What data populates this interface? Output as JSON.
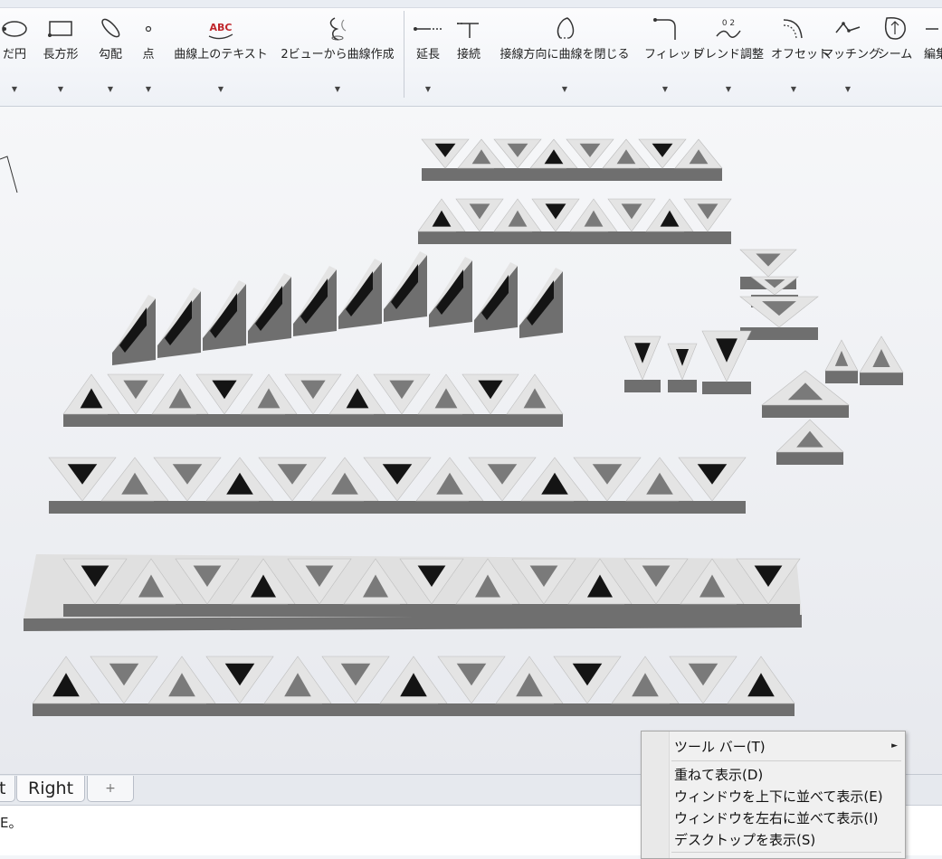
{
  "ribbon": {
    "tools_curve": [
      {
        "id": "ellipse",
        "label": "だ円",
        "icon": "ellipse-icon",
        "dropdown": true
      },
      {
        "id": "rectangle",
        "label": "長方形",
        "icon": "rectangle-icon",
        "dropdown": true
      },
      {
        "id": "gradient",
        "label": "勾配",
        "icon": "gradient-icon",
        "dropdown": true
      },
      {
        "id": "point",
        "label": "点",
        "icon": "point-icon",
        "dropdown": true
      },
      {
        "id": "text-on-curve",
        "label": "曲線上のテキスト",
        "icon": "text-on-curve-icon",
        "icon_text": "ABC",
        "dropdown": true
      },
      {
        "id": "curve-from-2-views",
        "label": "2ビューから曲線作成",
        "icon": "curve-from-2-views-icon",
        "dropdown": true
      }
    ],
    "tools_edit": [
      {
        "id": "extend",
        "label": "延長",
        "icon": "extend-icon",
        "dropdown": true
      },
      {
        "id": "connect",
        "label": "接続",
        "icon": "connect-icon",
        "dropdown": false
      },
      {
        "id": "close-tangent",
        "label": "接線方向に曲線を閉じる",
        "icon": "close-tangent-icon",
        "dropdown": true
      },
      {
        "id": "fillet",
        "label": "フィレット",
        "icon": "fillet-icon",
        "dropdown": true
      },
      {
        "id": "adjust-blend",
        "label": "ブレンド調整",
        "icon": "adjust-blend-icon",
        "icon_text": "0 2",
        "dropdown": true
      },
      {
        "id": "offset",
        "label": "オフセット",
        "icon": "offset-icon",
        "dropdown": true
      },
      {
        "id": "matching",
        "label": "マッチング",
        "icon": "matching-icon",
        "dropdown": true
      },
      {
        "id": "seam",
        "label": "シーム",
        "icon": "seam-icon",
        "dropdown": false
      },
      {
        "id": "edit",
        "label": "編集",
        "icon": "edit-icon",
        "dropdown": false
      }
    ]
  },
  "tabs": {
    "partial_label": "t",
    "active_label": "Right",
    "add_icon": "plus-icon",
    "add_glyph": "+"
  },
  "command_line": {
    "text": "E。"
  },
  "context_menu": {
    "items": [
      {
        "label": "ツール バー(T)",
        "submenu": true
      },
      {
        "label": "重ねて表示(D)",
        "submenu": false
      },
      {
        "label": "ウィンドウを上下に並べて表示(E)",
        "submenu": false
      },
      {
        "label": "ウィンドウを左右に並べて表示(I)",
        "submenu": false
      },
      {
        "label": "デスクトップを表示(S)",
        "submenu": false
      }
    ],
    "submenu_glyph": "►"
  },
  "colors": {
    "shape_top": "#e4e4e4",
    "shape_side": "#6f6f6f",
    "shape_shadow": "#141414",
    "accent_red": "#c0262b"
  }
}
